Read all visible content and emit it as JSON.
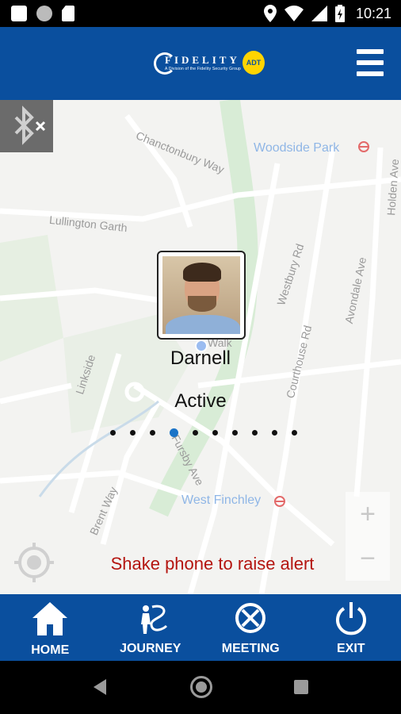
{
  "status_bar": {
    "time": "10:21",
    "icons": [
      "notification-square-icon",
      "circle-icon",
      "sim-card-icon",
      "location-pin-icon",
      "wifi-icon",
      "signal-icon",
      "battery-charging-icon"
    ]
  },
  "header": {
    "logo_text": "FIDELITY",
    "logo_subtitle": "A Division of the Fidelity Security Group",
    "logo_badge": "ADT",
    "menu_icon": "hamburger-menu-icon",
    "brand_color": "#0a4f9e"
  },
  "map": {
    "labels": {
      "woodside_park": "Woodside Park",
      "chanctonbury_way": "Chanctonbury Way",
      "lullington_garth": "Lullington Garth",
      "westbury_rd": "Westbury Rd",
      "avondale_ave": "Avondale Ave",
      "holden_ave": "Holden Ave",
      "courthouse_rd": "Courthouse Rd",
      "walk": "Walk",
      "linkside": "Linkside",
      "fursby_ave": "Fursby Ave",
      "west_finchley": "West Finchley",
      "brent_way": "Brent Way"
    },
    "bluetooth_icon": "bluetooth-disabled-icon",
    "zoom_in": "+",
    "zoom_out": "−"
  },
  "user": {
    "name": "Darnell",
    "status": "Active"
  },
  "pager": {
    "count": 10,
    "active_index": 3
  },
  "alert": {
    "text": "Shake phone to raise alert",
    "color": "#b4140f"
  },
  "bottom_nav": {
    "items": [
      {
        "label": "HOME",
        "icon": "home-icon"
      },
      {
        "label": "JOURNEY",
        "icon": "journey-icon"
      },
      {
        "label": "MEETING",
        "icon": "meeting-icon"
      },
      {
        "label": "EXIT",
        "icon": "power-icon"
      }
    ]
  }
}
